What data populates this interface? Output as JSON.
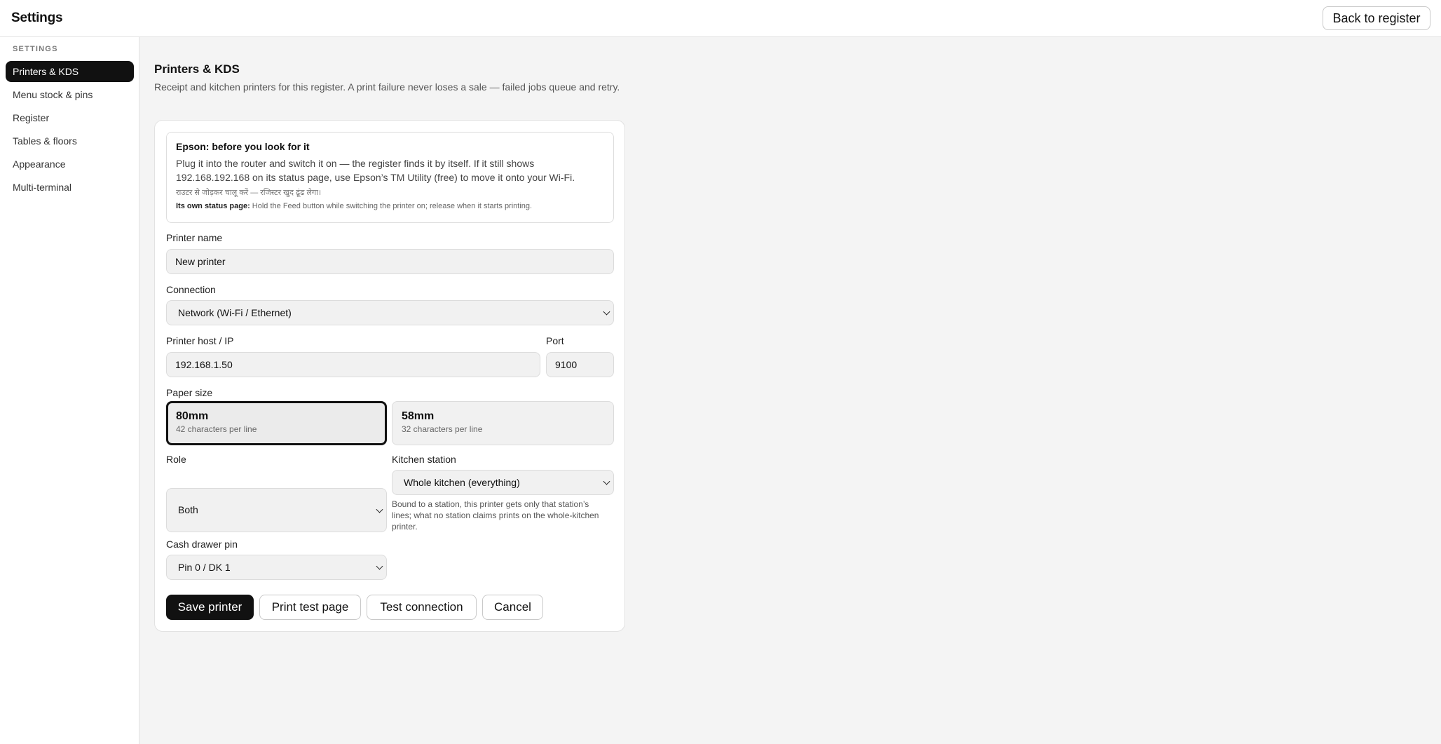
{
  "header": {
    "title": "Settings",
    "back_label": "Back to register"
  },
  "sidebar": {
    "section_label": "SETTINGS",
    "items": [
      {
        "label": "Printers & KDS",
        "active": true
      },
      {
        "label": "Menu stock & pins",
        "active": false
      },
      {
        "label": "Register",
        "active": false
      },
      {
        "label": "Tables & floors",
        "active": false
      },
      {
        "label": "Appearance",
        "active": false
      },
      {
        "label": "Multi-terminal",
        "active": false
      }
    ]
  },
  "main": {
    "title": "Printers & KDS",
    "description": "Receipt and kitchen printers for this register. A print failure never loses a sale — failed jobs queue and retry."
  },
  "info_box": {
    "heading": "Epson: before you look for it",
    "body": "Plug it into the router and switch it on — the register finds it by itself. If it still shows 192.168.192.168 on its status page, use Epson’s TM Utility (free) to move it onto your Wi-Fi.",
    "hindi": "राउटर से जोड़कर चालू करें — रजिस्टर खुद ढूंढ लेगा।",
    "status_label": "Its own status page:",
    "status_text": " Hold the Feed button while switching the printer on; release when it starts printing."
  },
  "form": {
    "printer_name_label": "Printer name",
    "printer_name_value": "New printer",
    "connection_label": "Connection",
    "connection_value": "Network (Wi-Fi / Ethernet)",
    "host_label": "Printer host / IP",
    "host_value": "192.168.1.50",
    "port_label": "Port",
    "port_value": "9100",
    "paper_label": "Paper size",
    "paper_options": [
      {
        "size": "80mm",
        "cpl": "42 characters per line",
        "selected": true
      },
      {
        "size": "58mm",
        "cpl": "32 characters per line",
        "selected": false
      }
    ],
    "role_label": "Role",
    "role_value": "Both",
    "station_label": "Kitchen station",
    "station_value": "Whole kitchen (everything)",
    "station_help": "Bound to a station, this printer gets only that station’s lines; what no station claims prints on the whole-kitchen printer.",
    "drawer_label": "Cash drawer pin",
    "drawer_value": "Pin 0 / DK 1"
  },
  "actions": {
    "save": "Save printer",
    "test_print": "Print test page",
    "test_connection": "Test connection",
    "cancel": "Cancel"
  },
  "icons": {
    "select_chevron": "chevron-down-icon"
  }
}
